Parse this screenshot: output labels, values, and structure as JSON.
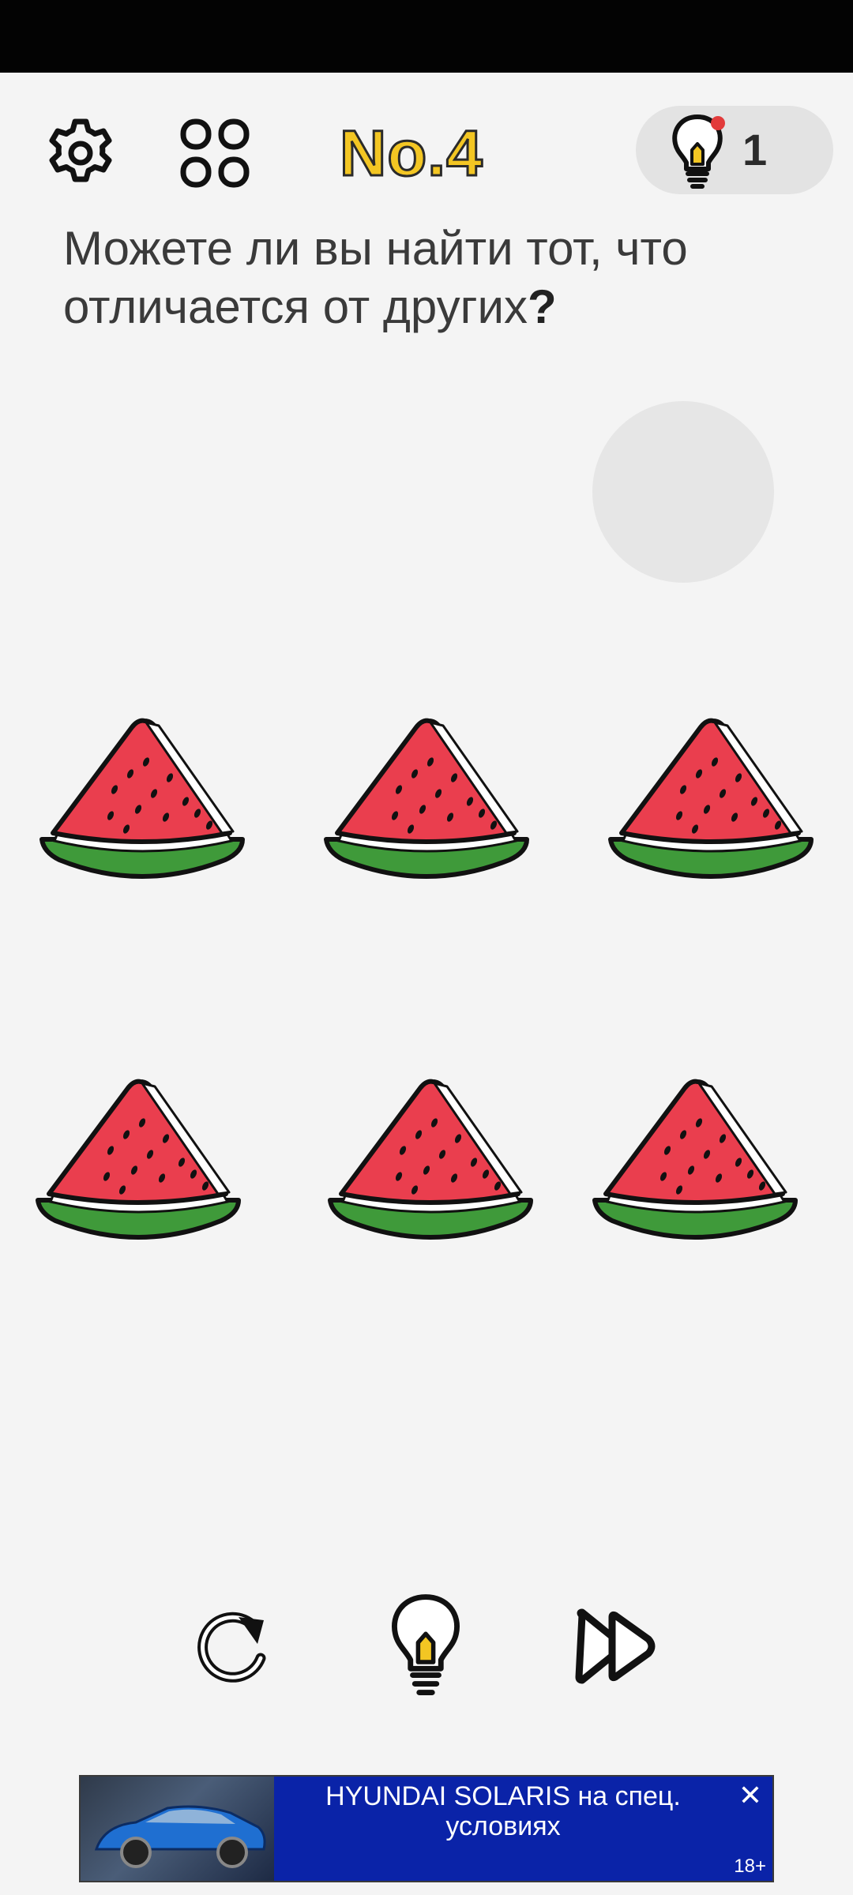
{
  "header": {
    "level_title": "No.4",
    "hint_count": "1",
    "settings_icon": "gear-icon",
    "levels_icon": "grid-icon",
    "hint_icon": "lightbulb-icon"
  },
  "question": {
    "text": "Можете ли вы найти тот, что отличается от других",
    "punctuation": "?"
  },
  "board": {
    "items": [
      {
        "name": "watermelon-slice-1"
      },
      {
        "name": "watermelon-slice-2"
      },
      {
        "name": "watermelon-slice-3"
      },
      {
        "name": "watermelon-slice-4"
      },
      {
        "name": "watermelon-slice-5"
      },
      {
        "name": "watermelon-slice-6"
      }
    ]
  },
  "controls": {
    "restart_icon": "restart-icon",
    "hint_icon": "lightbulb-icon",
    "skip_icon": "skip-icon"
  },
  "ad": {
    "text": "HYUNDAI SOLARIS на спец. условиях",
    "close": "✕",
    "age": "18+"
  },
  "colors": {
    "title_yellow": "#f3c623",
    "melon_red": "#ea3e4e",
    "rind_green": "#3f9a3a",
    "ad_blue": "#0a23a8"
  }
}
